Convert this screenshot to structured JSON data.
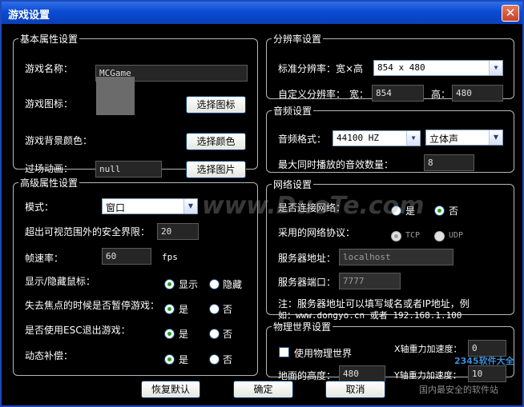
{
  "window": {
    "title": "游戏设置"
  },
  "basic": {
    "legend": "基本属性设置",
    "name_label": "游戏名称：",
    "name_value": "MCGame",
    "icon_label": "游戏图标：",
    "choose_icon": "选择图标",
    "bg_label": "游戏背景颜色：",
    "choose_color": "选择颜色",
    "transition_label": "过场动画：",
    "transition_value": "null",
    "choose_image": "选择图片"
  },
  "advanced": {
    "legend": "高级属性设置",
    "mode_label": "模式：",
    "mode_value": "窗口",
    "safe_label": "超出可视范围外的安全界限：",
    "safe_value": "20",
    "fps_label": "帧速率：",
    "fps_value": "60",
    "fps_unit": "fps",
    "mouse_label": "显示/隐藏鼠标：",
    "mouse_show": "显示",
    "mouse_hide": "隐藏",
    "pause_label": "失去焦点的时候是否暂停游戏：",
    "esc_label": "是否使用ESC退出游戏：",
    "comp_label": "动态补偿：",
    "yes": "是",
    "no": "否"
  },
  "resolution": {
    "legend": "分辨率设置",
    "std_label": "标准分辨率：宽×高",
    "std_value": "854 x 480",
    "custom_label": "自定义分辨率：",
    "w_label": "宽：",
    "w_value": "854",
    "h_label": "高：",
    "h_value": "480"
  },
  "audio": {
    "legend": "音频设置",
    "format_label": "音频格式：",
    "format_value": "44100 HZ",
    "channel_value": "立体声",
    "max_label": "最大同时播放的音效数量：",
    "max_value": "8"
  },
  "network": {
    "legend": "网络设置",
    "connect_label": "是否连接网络：",
    "yes": "是",
    "no": "否",
    "protocol_label": "采用的网络协议：",
    "tcp": "TCP",
    "udp": "UDP",
    "server_label": "服务器地址：",
    "server_value": "localhost",
    "port_label": "服务器端口：",
    "port_value": "7777",
    "note_line1": "注：服务器地址可以填写域名或者IP地址，例",
    "note_line2": "如：www.dongyo.cn 或者 192.168.1.100"
  },
  "physics": {
    "legend": "物理世界设置",
    "use_label": "使用物理世界",
    "xg_label": "X轴重力加速度：",
    "xg_value": "0",
    "ground_label": "地面的高度：",
    "ground_value": "480",
    "yg_label": "Y轴重力加速度：",
    "yg_value": "10"
  },
  "footer": {
    "restore": "恢复默认",
    "ok": "确定",
    "cancel": "取消"
  },
  "watermark": {
    "text": "www.DuoTe.com",
    "logo": "2345软件大全",
    "site": "国内最安全的软件站"
  }
}
